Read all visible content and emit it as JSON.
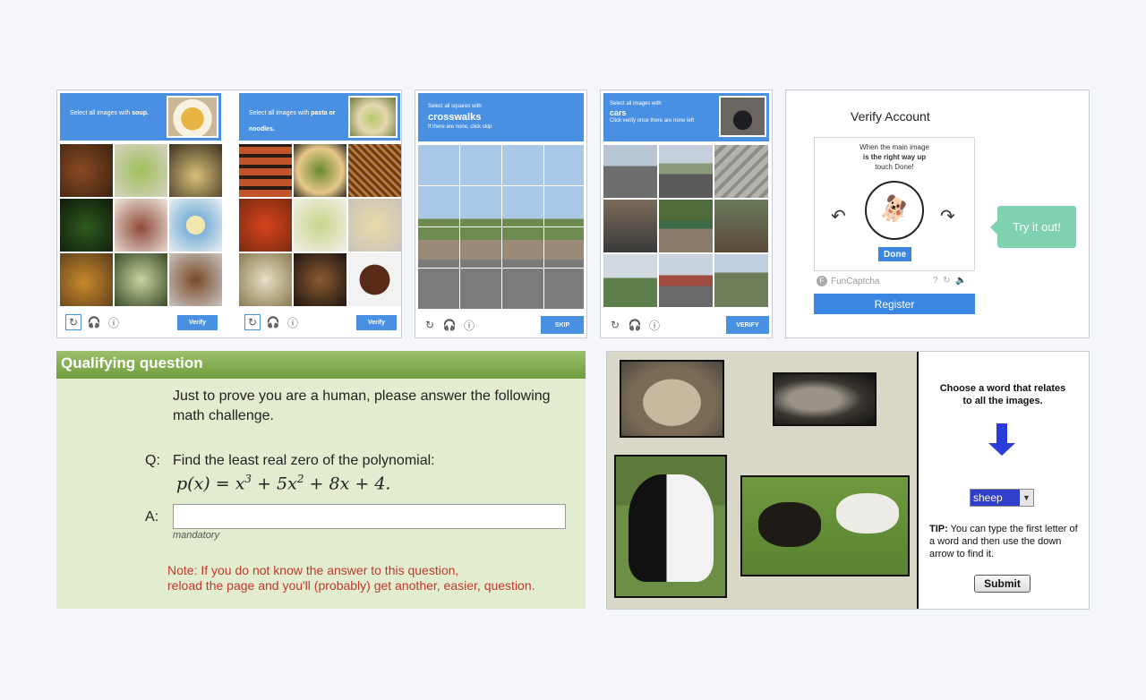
{
  "recaptcha_soup": {
    "instruction_prefix": "Select all images with",
    "instruction_bold": "soup.",
    "verify_label": "Verify"
  },
  "recaptcha_pasta": {
    "instruction_prefix": "Select all images with",
    "instruction_bold": "pasta or noodles.",
    "verify_label": "Verify"
  },
  "recaptcha_crosswalks": {
    "line1": "Select all squares with",
    "target": "crosswalks",
    "line3": "If there are none, click skip",
    "skip_label": "SKIP"
  },
  "recaptcha_cars": {
    "line1": "Select all images with",
    "target": "cars",
    "line3": "Click verify once there are none left",
    "verify_label": "VERIFY"
  },
  "funcaptcha": {
    "title": "Verify Account",
    "line1": "When the main image",
    "line2": "is the right way up",
    "line3": "touch Done!",
    "done_label": "Done",
    "brand": "FunCaptcha",
    "register_label": "Register",
    "try_label": "Try it out!"
  },
  "qualifying": {
    "header": "Qualifying question",
    "intro": "Just to prove you are a human, please answer the following math challenge.",
    "q_label": "Q:",
    "question": "Find the least real zero of the polynomial:",
    "a_label": "A:",
    "answer_value": "",
    "mandatory": "mandatory",
    "note_line1": "Note: If you do not know the answer to this question,",
    "note_line2": "reload the page and you'll (probably) get another, easier, question."
  },
  "word_captcha": {
    "prompt": "Choose a word that relates to all the images.",
    "selected": "sheep",
    "tip_bold": "TIP:",
    "tip": " You can type the first letter of a word and then use the down arrow to find it.",
    "submit_label": "Submit"
  },
  "colors": {
    "recaptcha_blue": "#4a90e2",
    "funcaptcha_green": "#7fd1b0",
    "qualifying_green": "#e2eccf",
    "note_red": "#c0392b"
  }
}
